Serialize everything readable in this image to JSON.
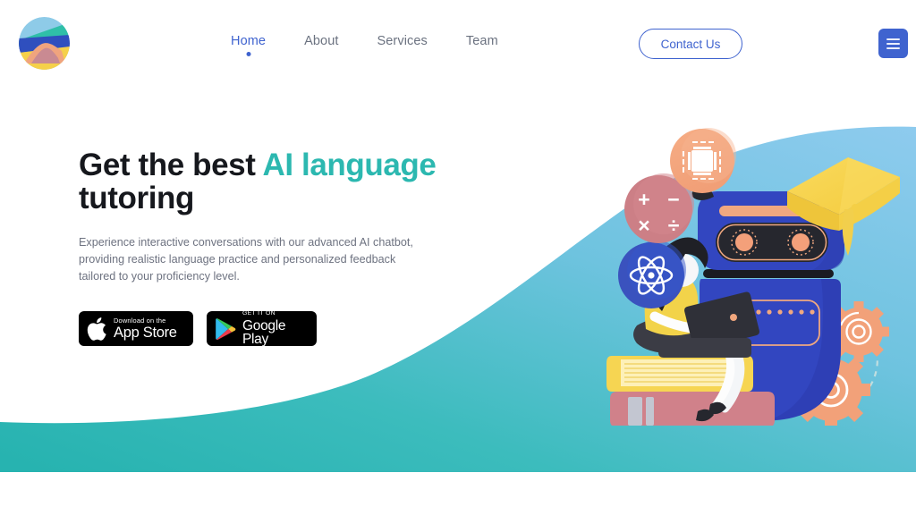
{
  "header": {
    "logo": {
      "name": "brand-logo",
      "alt": "mountain landscape circular logo"
    },
    "nav": [
      {
        "label": "Home",
        "active": true
      },
      {
        "label": "About",
        "active": false
      },
      {
        "label": "Services",
        "active": false
      },
      {
        "label": "Team",
        "active": false
      }
    ],
    "contact_label": "Contact Us",
    "menu_icon": "hamburger-menu-icon"
  },
  "hero": {
    "headline_part1": "Get the best ",
    "headline_accent": "AI language",
    "headline_part2": "tutoring",
    "subcopy": "Experience interactive conversations with our advanced AI chatbot, providing realistic language practice and personalized feedback tailored to your proficiency level.",
    "badges": [
      {
        "small": "Download on the",
        "big": "App Store",
        "icon": "apple-logo-icon"
      },
      {
        "small": "GET IT ON",
        "big": "Google Play",
        "icon": "google-play-icon"
      }
    ]
  },
  "illustration": {
    "alt": "AI tutoring illustration: blue robot with graduation cap, student on books with laptop, floating icon badges and gears",
    "badges": [
      {
        "icon": "cpu-chip-icon",
        "color": "#f4a582"
      },
      {
        "icon": "math-operators-icon",
        "color": "#cc7f86",
        "symbols": [
          "+",
          "−",
          "×",
          "÷"
        ]
      },
      {
        "icon": "atom-icon",
        "color": "#3a52be"
      }
    ],
    "elements": [
      "robot",
      "graduation-cap",
      "student-with-laptop",
      "book-stack",
      "gears"
    ]
  },
  "colors": {
    "accent_teal": "#2cb8b0",
    "brand_blue": "#3f63cf",
    "wave_top": "#7cc2e8",
    "wave_bottom": "#2fb7b2",
    "robot_blue": "#3246c0",
    "cap_yellow": "#f7d14a",
    "orange": "#f4a582",
    "book_rose": "#d07f86",
    "text_dark": "#16181d",
    "text_muted": "#6d7280"
  }
}
